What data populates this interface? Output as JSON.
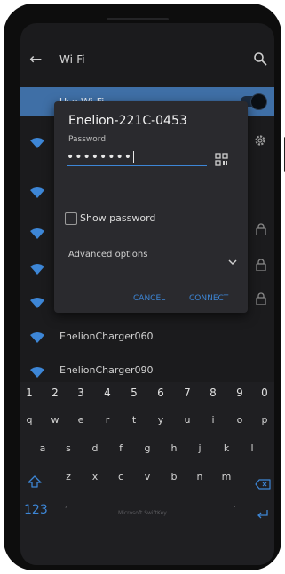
{
  "topbar": {
    "title": "Wi-Fi"
  },
  "wifi_toggle": {
    "label": "Use Wi-Fi",
    "on": true
  },
  "networks": [
    {
      "name": ""
    },
    {
      "name": ""
    },
    {
      "name": ""
    },
    {
      "name": ""
    },
    {
      "name": ""
    },
    {
      "name": "EnelionCharger060"
    },
    {
      "name": "EnelionCharger090"
    }
  ],
  "dialog": {
    "title": "Enelion-221C-0453",
    "password_label": "Password",
    "password_value": "••••••••",
    "show_password_label": "Show password",
    "show_password_checked": false,
    "advanced_label": "Advanced options",
    "cancel_label": "CANCEL",
    "connect_label": "CONNECT"
  },
  "keyboard": {
    "row_numbers": [
      "1",
      "2",
      "3",
      "4",
      "5",
      "6",
      "7",
      "8",
      "9",
      "0"
    ],
    "row1": [
      "q",
      "w",
      "e",
      "r",
      "t",
      "y",
      "u",
      "i",
      "o",
      "p"
    ],
    "row2": [
      "a",
      "s",
      "d",
      "f",
      "g",
      "h",
      "j",
      "k",
      "l"
    ],
    "row3": [
      "z",
      "x",
      "c",
      "v",
      "b",
      "n",
      "m"
    ],
    "mode_label": "123",
    "space_label": "Microsoft SwiftKey"
  },
  "colors": {
    "accent": "#3d86d6",
    "toggle_row": "#3f6fa6",
    "dialog_bg": "#2a2a2e",
    "screen_bg": "#1b1b1d"
  }
}
